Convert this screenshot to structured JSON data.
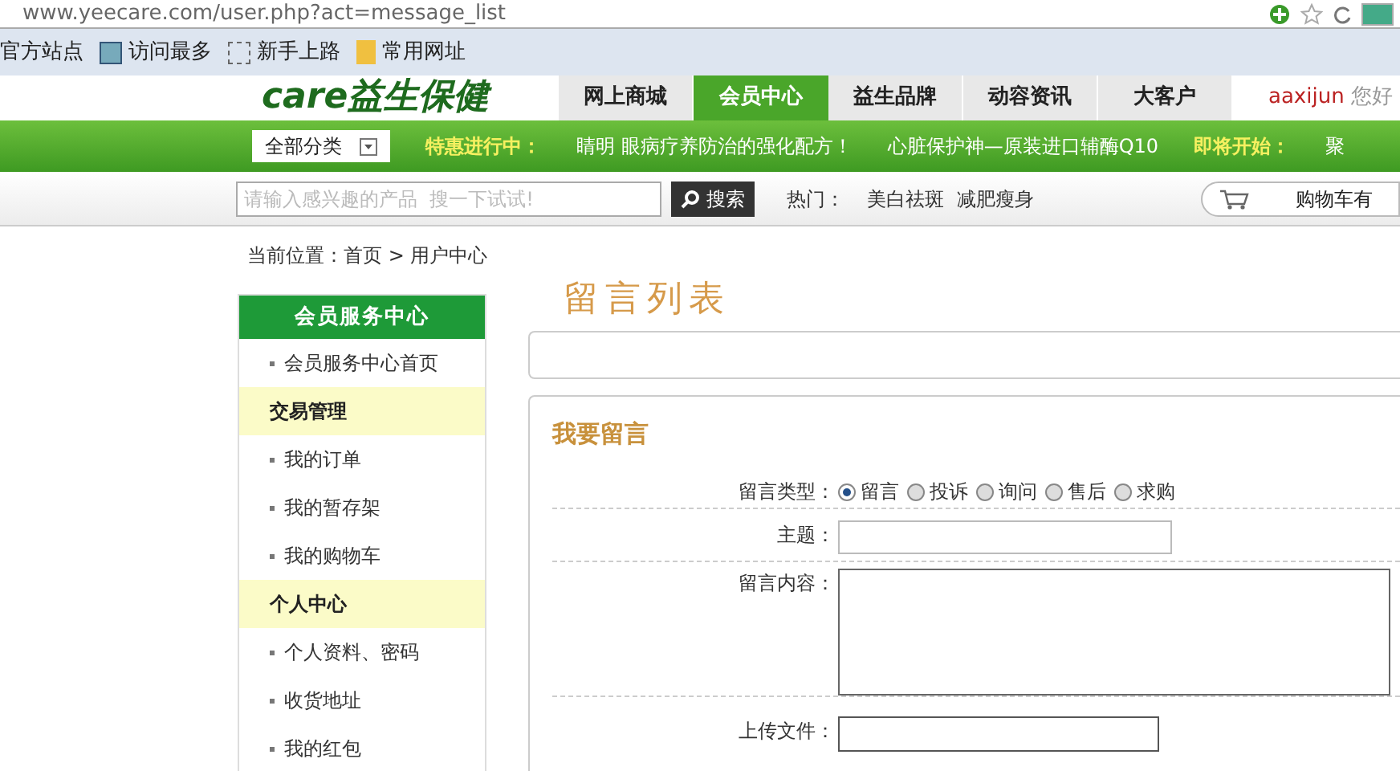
{
  "browser": {
    "url": "www.yeecare.com/user.php?act=message_list",
    "bookmarks": [
      "官方站点",
      "访问最多",
      "新手上路",
      "常用网址"
    ]
  },
  "header": {
    "logo": "care益生保健",
    "nav": [
      {
        "label": "网上商城",
        "selected": false
      },
      {
        "label": "会员中心",
        "selected": true
      },
      {
        "label": "益生品牌",
        "selected": false
      },
      {
        "label": "动容资讯",
        "selected": false
      },
      {
        "label": "大客户",
        "selected": false
      }
    ],
    "user": "aaxijun",
    "greeting": "您好"
  },
  "promo_bar": {
    "category": "全部分类",
    "promos": [
      {
        "kind": "heading",
        "text": "特惠进行中："
      },
      {
        "kind": "link",
        "text": "睛明 眼病疗养防治的强化配方！"
      },
      {
        "kind": "link",
        "text": "心脏保护神—原装进口辅酶Q10"
      },
      {
        "kind": "heading",
        "text": "即将开始："
      },
      {
        "kind": "link",
        "text": "聚"
      }
    ]
  },
  "search": {
    "placeholder": "请输入感兴趣的产品  搜一下试试!",
    "button": "搜索",
    "hot_label": "热门：",
    "hot": [
      "美白祛斑",
      "减肥瘦身"
    ],
    "cart": "购物车有"
  },
  "breadcrumb": "当前位置：首页 > 用户中心",
  "sidebar": {
    "title": "会员服务中心",
    "items": [
      {
        "kind": "link",
        "label": "会员服务中心首页"
      },
      {
        "kind": "section",
        "label": "交易管理"
      },
      {
        "kind": "link",
        "label": "我的订单"
      },
      {
        "kind": "link",
        "label": "我的暂存架"
      },
      {
        "kind": "link",
        "label": "我的购物车"
      },
      {
        "kind": "section",
        "label": "个人中心"
      },
      {
        "kind": "link",
        "label": "个人资料、密码"
      },
      {
        "kind": "link",
        "label": "收货地址"
      },
      {
        "kind": "link",
        "label": "我的红包"
      }
    ]
  },
  "main": {
    "title": "留言列表",
    "form": {
      "title": "我要留言",
      "type_label": "留言类型：",
      "types": [
        {
          "label": "留言",
          "selected": true
        },
        {
          "label": "投诉",
          "selected": false
        },
        {
          "label": "询问",
          "selected": false
        },
        {
          "label": "售后",
          "selected": false
        },
        {
          "label": "求购",
          "selected": false
        }
      ],
      "subject_label": "主题：",
      "content_label": "留言内容：",
      "upload_label": "上传文件："
    }
  }
}
